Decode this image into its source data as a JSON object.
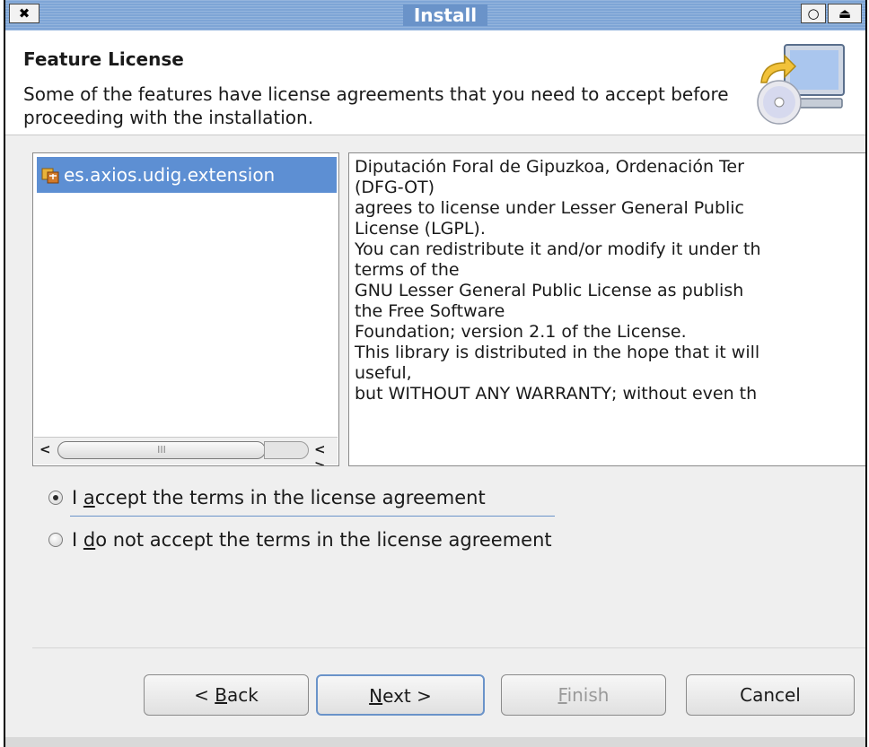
{
  "window": {
    "title": "Install",
    "close_glyph": "✖",
    "min_glyph": "○",
    "max_glyph": "⏏"
  },
  "header": {
    "title": "Feature License",
    "description": "Some of the features have license agreements that you need to accept before proceeding with the installation.",
    "icon": "install-wizard-icon"
  },
  "features": {
    "items": [
      {
        "label": "es.axios.udig.extension",
        "icon": "feature-icon",
        "selected": true
      }
    ],
    "scroll_left": "<",
    "scroll_thumb": "III",
    "scroll_arrows": "< >"
  },
  "license": {
    "lines": [
      "Diputación Foral de Gipuzkoa, Ordenación Ter",
      "(DFG-OT)",
      "agrees to license under Lesser General Public",
      "License (LGPL).",
      "You can redistribute it and/or modify it under th",
      "terms of the",
      "GNU Lesser General Public License as publish",
      "the Free Software",
      "Foundation; version 2.1 of the License.",
      "This library is distributed in the hope that it will",
      "useful,",
      "but WITHOUT ANY WARRANTY; without even th"
    ]
  },
  "options": {
    "accept": {
      "pre": "I ",
      "mnemonic": "a",
      "post": "ccept the terms in the license agreement",
      "checked": true
    },
    "decline": {
      "pre": "I ",
      "mnemonic": "d",
      "post": "o not accept the terms in the license agreement",
      "checked": false
    }
  },
  "buttons": {
    "back": {
      "pre": "< ",
      "mnemonic": "B",
      "post": "ack"
    },
    "next": {
      "pre": "",
      "mnemonic": "N",
      "post": "ext >"
    },
    "finish": {
      "pre": "",
      "mnemonic": "F",
      "post": "inish",
      "enabled": false
    },
    "cancel": {
      "label": "Cancel"
    }
  },
  "colors": {
    "titlebar": "#7ea5d6",
    "selection": "#5d8fd3",
    "focus": "#6a93c9"
  }
}
